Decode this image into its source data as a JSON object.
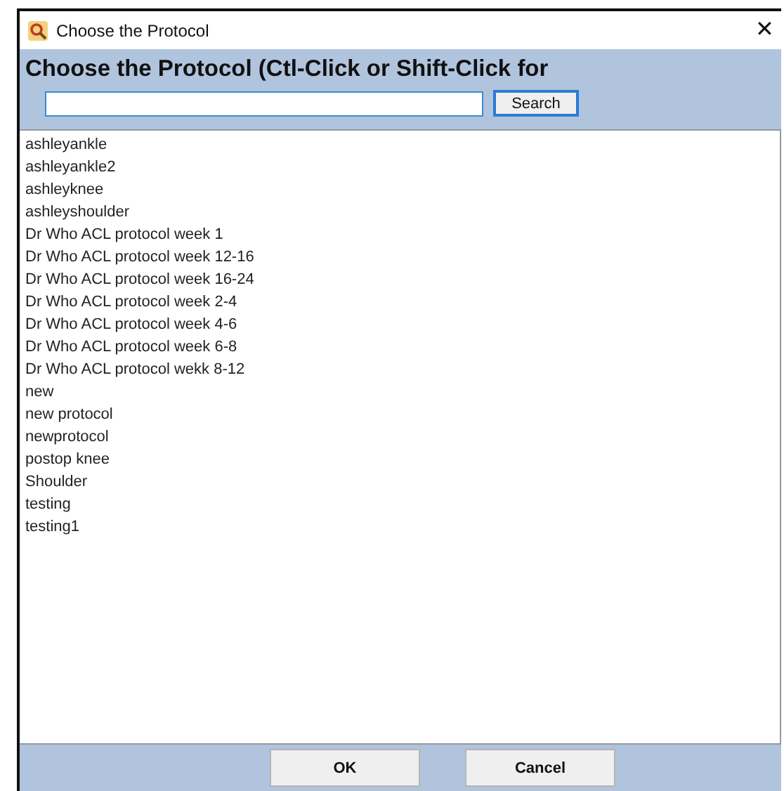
{
  "window": {
    "title": "Choose the Protocol",
    "close": "✕"
  },
  "header": {
    "heading": "Choose the Protocol (Ctl-Click or Shift-Click for",
    "search_button": "Search"
  },
  "list": {
    "items": [
      {
        "label": "ashleyankle"
      },
      {
        "label": "ashleyankle2"
      },
      {
        "label": "ashleyknee"
      },
      {
        "label": "ashleyshoulder"
      },
      {
        "label": "Dr Who ACL protocol week 1"
      },
      {
        "label": "Dr Who ACL protocol week 12-16"
      },
      {
        "label": "Dr Who ACL protocol week 16-24"
      },
      {
        "label": "Dr Who ACL protocol week 2-4"
      },
      {
        "label": "Dr Who ACL protocol week 4-6"
      },
      {
        "label": "Dr Who ACL protocol week 6-8"
      },
      {
        "label": "Dr Who ACL protocol wekk 8-12"
      },
      {
        "label": "new"
      },
      {
        "label": "new protocol"
      },
      {
        "label": "newprotocol"
      },
      {
        "label": "postop knee"
      },
      {
        "label": "Shoulder"
      },
      {
        "label": "testing"
      },
      {
        "label": "testing1"
      }
    ]
  },
  "buttons": [
    {
      "label": "OK"
    },
    {
      "label": "Cancel"
    }
  ]
}
